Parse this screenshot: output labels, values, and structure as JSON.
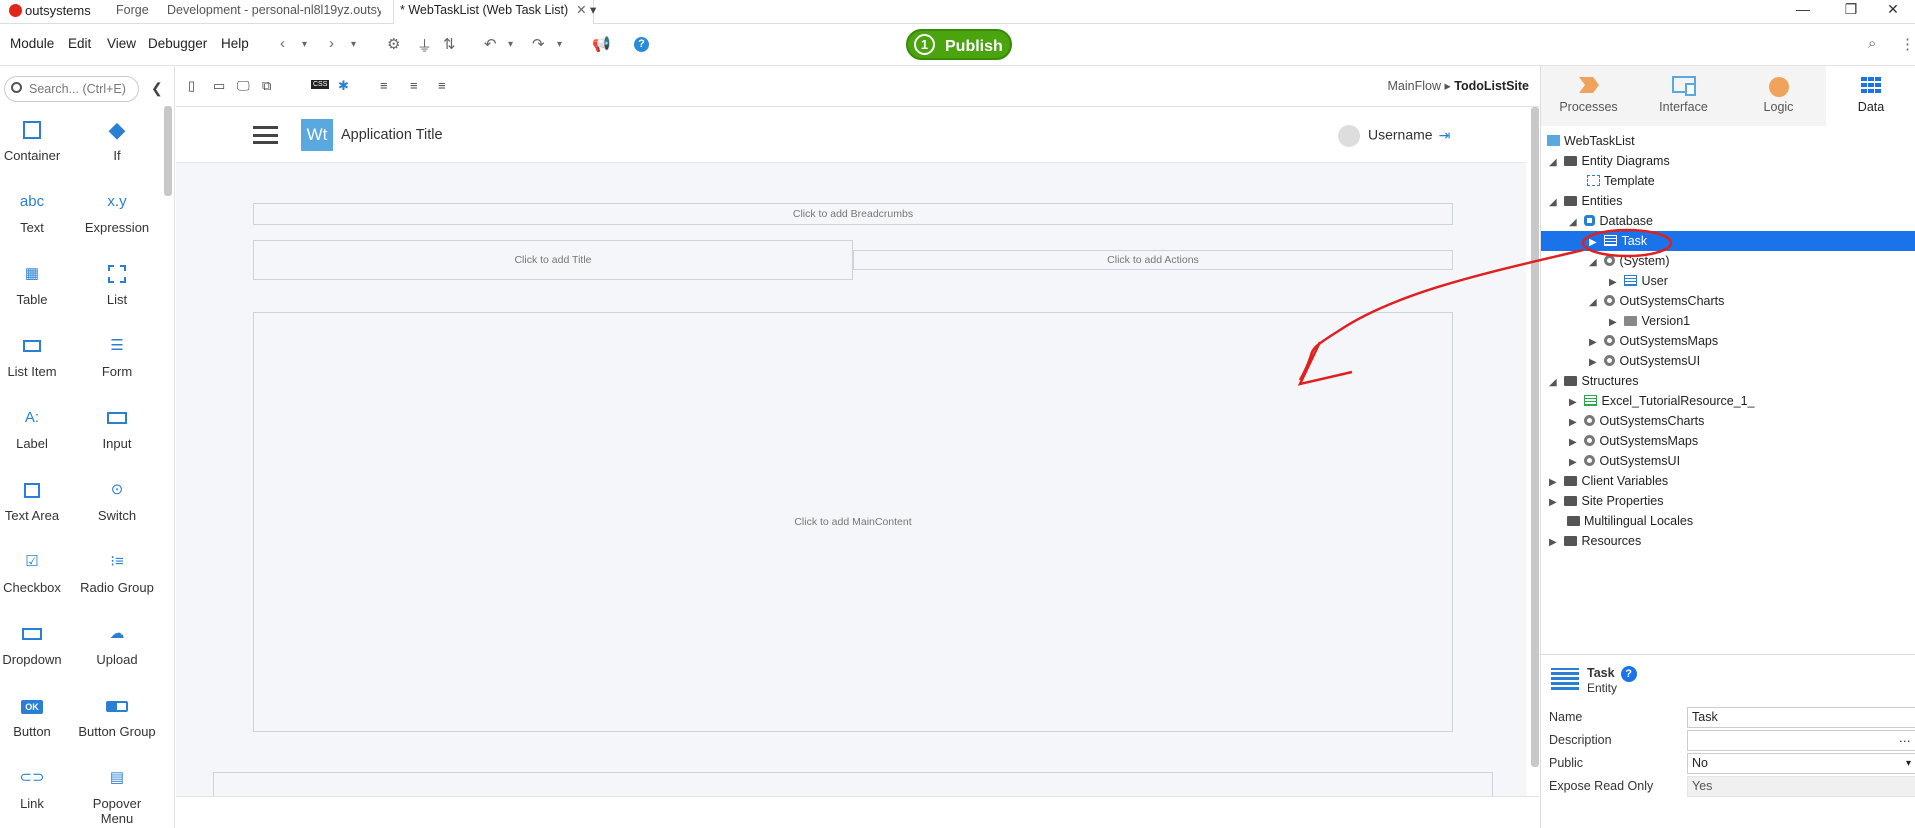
{
  "titlebar": {
    "brand": "outsystems",
    "tabs": [
      "Forge",
      "Development - personal-nl8l19yz.outsy",
      "* WebTaskList (Web Task List)"
    ]
  },
  "menu": {
    "items": [
      "Module",
      "Edit",
      "View",
      "Debugger",
      "Help"
    ],
    "publish_count": "1",
    "publish_label": "Publish",
    "help": "?"
  },
  "left": {
    "search_placeholder": "Search... (Ctrl+E)",
    "widgets": [
      {
        "label": "Container",
        "icon": "container-icon"
      },
      {
        "label": "If",
        "icon": "if-icon"
      },
      {
        "label": "Text",
        "icon_text": "abc"
      },
      {
        "label": "Expression",
        "icon_text": "x.y"
      },
      {
        "label": "Table",
        "icon": "table-icon"
      },
      {
        "label": "List",
        "icon": "list-icon"
      },
      {
        "label": "List Item",
        "icon": "list-item-icon"
      },
      {
        "label": "Form",
        "icon": "form-icon"
      },
      {
        "label": "Label",
        "icon_text": "A:"
      },
      {
        "label": "Input",
        "icon": "input-icon"
      },
      {
        "label": "Text Area",
        "icon": "text-area-icon"
      },
      {
        "label": "Switch",
        "icon": "switch-icon"
      },
      {
        "label": "Checkbox",
        "icon": "checkbox-icon"
      },
      {
        "label": "Radio Group",
        "icon": "radio-group-icon"
      },
      {
        "label": "Dropdown",
        "icon": "dropdown-icon"
      },
      {
        "label": "Upload",
        "icon": "upload-icon"
      },
      {
        "label": "Button",
        "icon_text": "OK"
      },
      {
        "label": "Button Group",
        "icon": "button-group-icon"
      },
      {
        "label": "Link",
        "icon": "link-icon"
      },
      {
        "label": "Popover Menu",
        "icon": "popover-menu-icon"
      }
    ]
  },
  "canvas": {
    "css_label": "CSS",
    "breadcrumb_flow": "MainFlow",
    "breadcrumb_screen": "TodoListSite",
    "app_logo": "Wt",
    "app_title": "Application Title",
    "username": "Username",
    "ph_breadcrumbs": "Click to add Breadcrumbs",
    "ph_title": "Click to add Title",
    "ph_actions": "Click to add Actions",
    "ph_main": "Click to add MainContent"
  },
  "right": {
    "tabs": [
      "Processes",
      "Interface",
      "Logic",
      "Data"
    ],
    "tree": [
      {
        "label": "WebTaskList"
      },
      {
        "label": "Entity Diagrams"
      },
      {
        "label": "Template"
      },
      {
        "label": "Entities"
      },
      {
        "label": "Database"
      },
      {
        "label": "Task"
      },
      {
        "label": "(System)"
      },
      {
        "label": "User"
      },
      {
        "label": "OutSystemsCharts"
      },
      {
        "label": "Version1"
      },
      {
        "label": "OutSystemsMaps"
      },
      {
        "label": "OutSystemsUI"
      },
      {
        "label": "Structures"
      },
      {
        "label": "Excel_TutorialResource_1_"
      },
      {
        "label": "OutSystemsCharts"
      },
      {
        "label": "OutSystemsMaps"
      },
      {
        "label": "OutSystemsUI"
      },
      {
        "label": "Client Variables"
      },
      {
        "label": "Site Properties"
      },
      {
        "label": "Multilingual Locales"
      },
      {
        "label": "Resources"
      }
    ],
    "props": {
      "title": "Task",
      "subtitle": "Entity",
      "help": "?",
      "name_label": "Name",
      "name_value": "Task",
      "desc_label": "Description",
      "desc_value": "",
      "public_label": "Public",
      "public_value": "No",
      "expose_label": "Expose Read Only",
      "expose_value": "Yes"
    }
  },
  "annotation_color": "#e02020",
  "accent_color": "#1a73e8",
  "publish_color": "#49a40e"
}
